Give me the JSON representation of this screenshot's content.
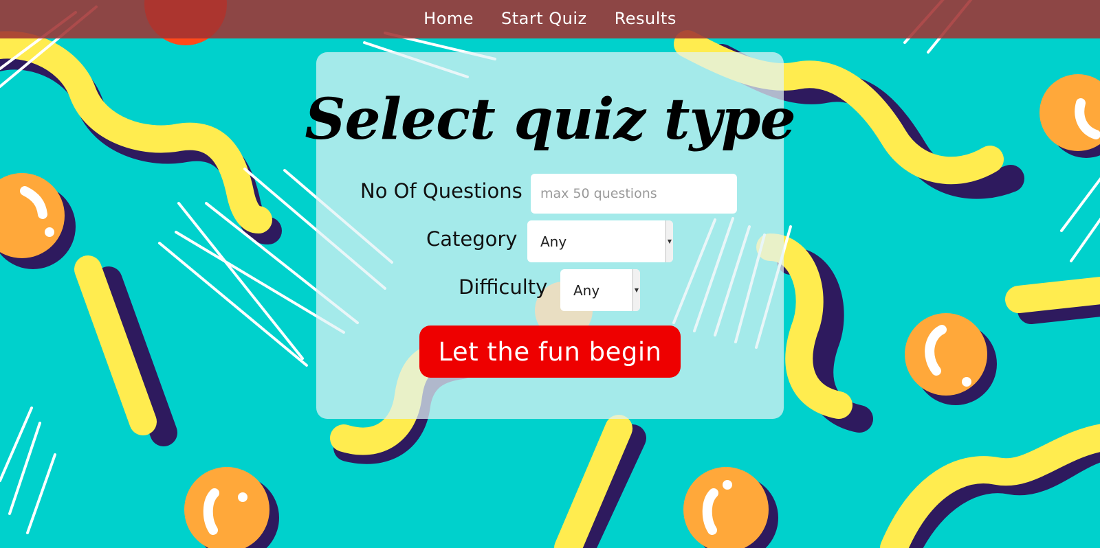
{
  "nav": {
    "items": [
      {
        "label": "Home"
      },
      {
        "label": "Start Quiz"
      },
      {
        "label": "Results"
      }
    ]
  },
  "form": {
    "title": "Select quiz type",
    "questions": {
      "label": "No Of Questions",
      "value": "",
      "placeholder": "max 50 questions"
    },
    "category": {
      "label": "Category",
      "selected": "Any"
    },
    "difficulty": {
      "label": "Difficulty",
      "selected": "Any"
    },
    "submit_label": "Let the fun begin"
  },
  "colors": {
    "background": "#00d1cc",
    "navbar": "#a03232",
    "button": "#ee0000",
    "squiggle_yellow": "#ffec4f",
    "squiggle_shadow": "#2e1a5e",
    "ball_orange": "#ffa83a",
    "ball_red": "#ff4a1a"
  },
  "icons": {
    "select_arrow": "caret-down-icon"
  }
}
